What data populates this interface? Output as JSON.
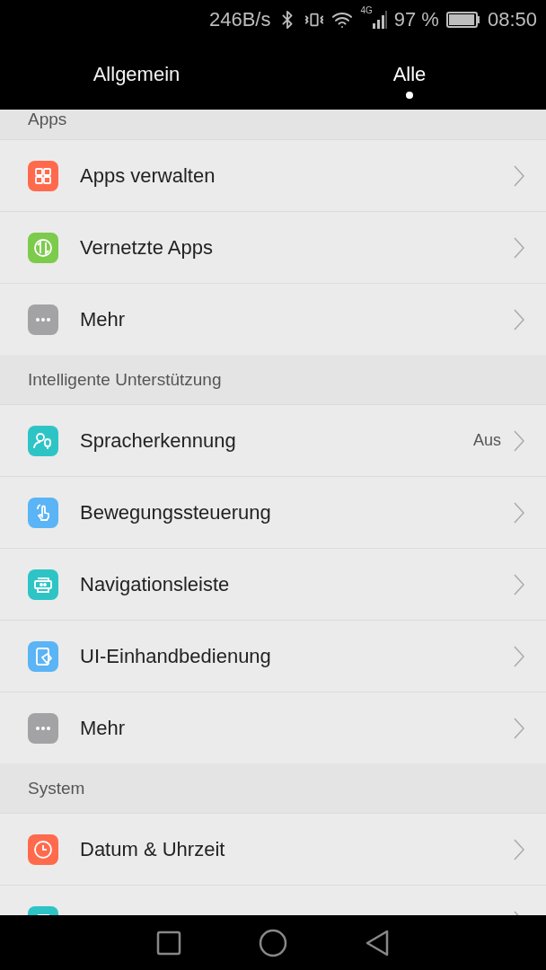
{
  "status_bar": {
    "speed": "246B/s",
    "network": "4G",
    "battery_text": "97 %",
    "battery": {
      "level": 0.97
    },
    "time": "08:50"
  },
  "tabs": [
    {
      "label": "Allgemein",
      "selected": false
    },
    {
      "label": "Alle",
      "selected": true
    }
  ],
  "sections": [
    {
      "title": "Apps",
      "items": [
        {
          "label": "Apps verwalten",
          "kind": "grid",
          "color": "#ff6a4d"
        },
        {
          "label": "Vernetzte Apps",
          "kind": "sync",
          "color": "#7ccb4c"
        },
        {
          "label": "Mehr",
          "kind": "more",
          "color": "#a3a3a6"
        }
      ]
    },
    {
      "title": "Intelligente Unterstützung",
      "items": [
        {
          "label": "Spracherkennung",
          "value": "Aus",
          "kind": "voice",
          "color": "#2ec4c6"
        },
        {
          "label": "Bewegungssteuerung",
          "kind": "gesture",
          "color": "#5ab4f5"
        },
        {
          "label": "Navigationsleiste",
          "kind": "navbar",
          "color": "#2ec4c6"
        },
        {
          "label": "UI-Einhandbedienung",
          "kind": "onehand",
          "color": "#5ab4f5"
        },
        {
          "label": "Mehr",
          "kind": "more",
          "color": "#a3a3a6"
        }
      ]
    },
    {
      "title": "System",
      "items": [
        {
          "label": "Datum & Uhrzeit",
          "kind": "clock",
          "color": "#ff6a4d"
        },
        {
          "kind": "navbar",
          "color": "#2ec4c6"
        }
      ]
    }
  ]
}
